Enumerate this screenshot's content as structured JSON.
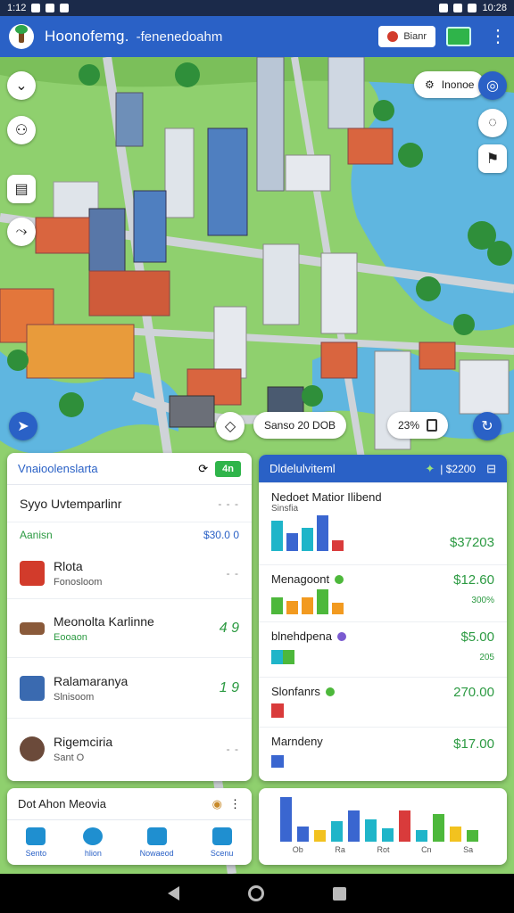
{
  "status_bar": {
    "time": "1:12",
    "right": "10:28"
  },
  "app": {
    "title": "Hoonofemg.",
    "subtitle": "-fenenedoahm",
    "button_label": "Bianr",
    "logo_icon": "tree-icon",
    "accent": "#2a61c6"
  },
  "map": {
    "top_right_chip": "Inonoe",
    "bottom_center_chip": "Sanso 20 DOB",
    "bottom_right_chip": "23%",
    "left_buttons": [
      "chevron-down-icon",
      "person-icon",
      "document-icon",
      "route-icon"
    ],
    "right_buttons": [
      "location-icon",
      "chat-icon",
      "flag-icon"
    ]
  },
  "left_card": {
    "title": "Vnaioolenslarta",
    "badge": "4n",
    "heading": "Syyo Uvtemparlinr",
    "section_label": "Aanisn",
    "section_value": "$30.0 0",
    "items": [
      {
        "name": "Rlota",
        "sub": "Fonosloom",
        "value": "",
        "color": "#d23b2b"
      },
      {
        "name": "Meonolta Karlinne",
        "sub": "Eooaon",
        "value": "4 9",
        "color": "#8a5a3a"
      },
      {
        "name": "Ralamaranya",
        "sub": "Slnisoom",
        "value": "1 9",
        "color": "#3a6ab0"
      },
      {
        "name": "Rigemciria",
        "sub": "Sant O",
        "value": "",
        "color": "#6b4a3a"
      }
    ]
  },
  "left_bottom_card": {
    "title": "Dot Ahon Meovia",
    "nav": [
      "Sento",
      "hlion",
      "Nowaeod",
      "Scenu"
    ]
  },
  "right_card": {
    "title": "Dldelulviteml",
    "header_value": "| $2200",
    "rows": [
      {
        "label": "Nedoet Matior Ilibend",
        "sub": "Sinsfia",
        "amount": "$37203",
        "subvalue": ""
      },
      {
        "label": "Menagoont",
        "sub": "",
        "amount": "$12.60",
        "subvalue": "300%"
      },
      {
        "label": "blnehdpena",
        "sub": "",
        "amount": "$5.00",
        "subvalue": "205"
      },
      {
        "label": "Slonfanrs",
        "sub": "",
        "amount": "270.00",
        "subvalue": ""
      },
      {
        "label": "Marndeny",
        "sub": "",
        "amount": "$17.00",
        "subvalue": ""
      }
    ]
  },
  "right_bottom_card": {
    "labels": [
      "Ob",
      "Ra",
      "Rot",
      "Cn",
      "Sa"
    ]
  },
  "chart_data": {
    "type": "bar",
    "series": [
      {
        "values": [
          34,
          20,
          26,
          40,
          12
        ],
        "colors": [
          "#1fb5c9",
          "#3a66d0",
          "#1fb5c9",
          "#3a66d0",
          "#d93b3b"
        ]
      },
      {
        "values": [
          18,
          14,
          18,
          26,
          12
        ],
        "colors": [
          "#4db83b",
          "#f29a20",
          "#f29a20",
          "#4db83b",
          "#f29a20"
        ]
      },
      {
        "values": [
          14,
          14
        ],
        "colors": [
          "#1fb5c9",
          "#4db83b"
        ]
      },
      {
        "values": [
          14
        ],
        "colors": [
          "#d93b3b"
        ]
      },
      {
        "values": [
          12
        ],
        "colors": [
          "#3a66d0"
        ]
      },
      {
        "values": [
          48,
          16,
          12,
          22,
          34,
          24,
          14,
          34,
          12,
          30,
          16,
          12
        ],
        "colors": [
          "#3a66d0",
          "#3a66d0",
          "#f2c21f",
          "#1fb5c9",
          "#3a66d0",
          "#1fb5c9",
          "#1fb5c9",
          "#d93b3b",
          "#1fb5c9",
          "#4db83b",
          "#f2c21f",
          "#4db83b"
        ]
      }
    ]
  }
}
